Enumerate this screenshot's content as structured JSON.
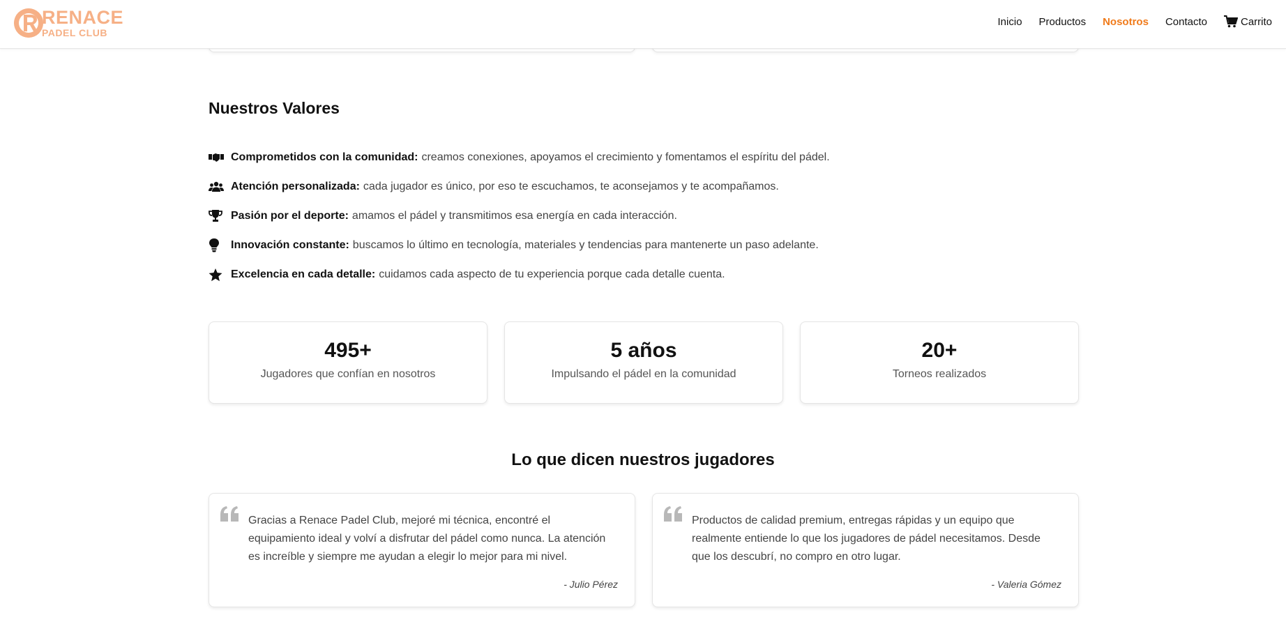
{
  "header": {
    "brand_name": "RENACE",
    "brand_sub": "PADEL CLUB",
    "nav": [
      {
        "label": "Inicio"
      },
      {
        "label": "Productos"
      },
      {
        "label": "Nosotros"
      },
      {
        "label": "Contacto"
      }
    ],
    "cart_label": "Carrito",
    "active_nav": "Nosotros",
    "accent_color": "#f07b1b",
    "brand_color": "#f6b086"
  },
  "values": {
    "title": "Nuestros Valores",
    "items": [
      {
        "icon": "handshake-icon",
        "title": "Comprometidos con la comunidad:",
        "text": "creamos conexiones, apoyamos el crecimiento y fomentamos el espíritu del pádel."
      },
      {
        "icon": "users-icon",
        "title": "Atención personalizada:",
        "text": "cada jugador es único, por eso te escuchamos, te aconsejamos y te acompañamos."
      },
      {
        "icon": "trophy-icon",
        "title": "Pasión por el deporte:",
        "text": "amamos el pádel y transmitimos esa energía en cada interacción."
      },
      {
        "icon": "lightbulb-icon",
        "title": "Innovación constante:",
        "text": "buscamos lo último en tecnología, materiales y tendencias para mantenerte un paso adelante."
      },
      {
        "icon": "star-icon",
        "title": "Excelencia en cada detalle:",
        "text": "cuidamos cada aspecto de tu experiencia porque cada detalle cuenta."
      }
    ]
  },
  "stats": [
    {
      "number": "495+",
      "label": "Jugadores que confían en nosotros"
    },
    {
      "number": "5 años",
      "label": "Impulsando el pádel en la comunidad"
    },
    {
      "number": "20+",
      "label": "Torneos realizados"
    }
  ],
  "testimonials": {
    "title": "Lo que dicen nuestros jugadores",
    "items": [
      {
        "text": "Gracias a Renace Padel Club, mejoré mi técnica, encontré el equipamiento ideal y volví a disfrutar del pádel como nunca. La atención es increíble y siempre me ayudan a elegir lo mejor para mi nivel.",
        "author": "- Julio Pérez"
      },
      {
        "text": "Productos de calidad premium, entregas rápidas y un equipo que realmente entiende lo que los jugadores de pádel necesitamos. Desde que los descubrí, no compro en otro lugar.",
        "author": "- Valeria Gómez"
      }
    ]
  }
}
